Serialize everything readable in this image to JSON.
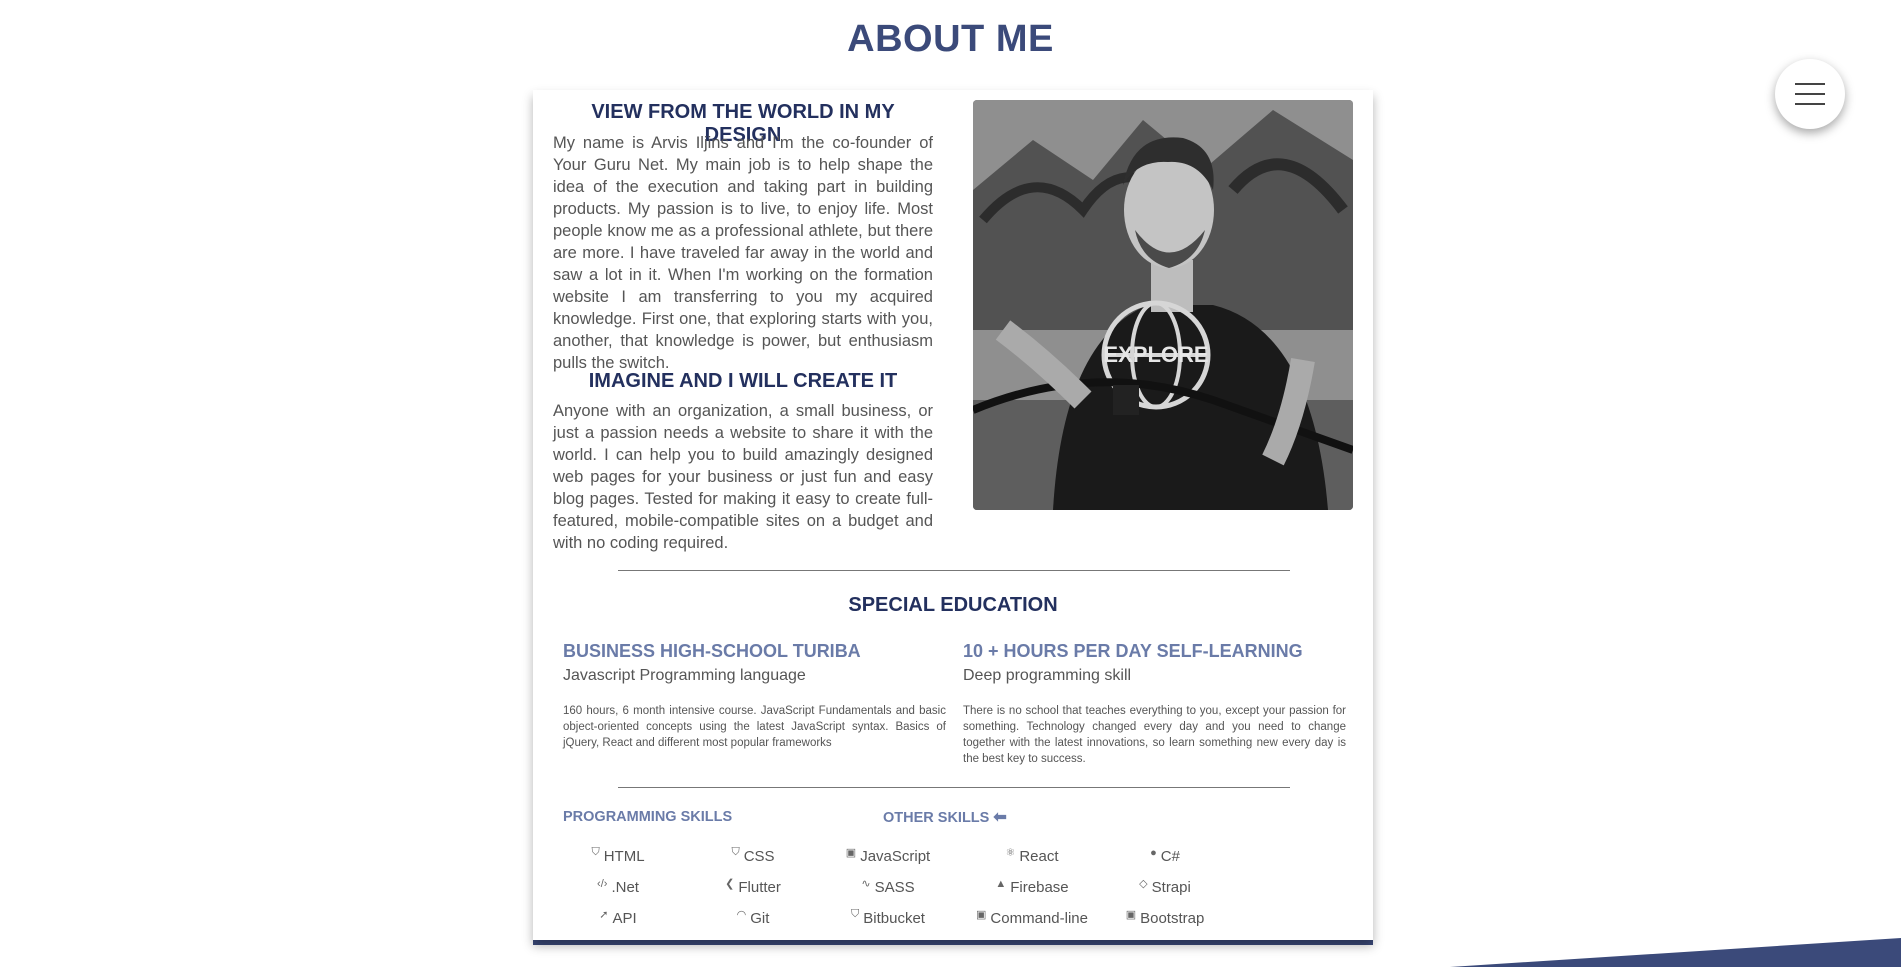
{
  "page": {
    "title": "ABOUT ME"
  },
  "about": {
    "heading1": "VIEW FROM THE WORLD IN MY DESIGN",
    "para1": "My name is Arvis Iljins and I'm the co-founder of Your Guru Net. My main job is to help shape the idea of the execution and taking part in building products. My passion is to live, to enjoy life. Most people know me as a professional athlete, but there are more. I have traveled far away in the world and saw a lot in it. When I'm working on the formation website I am transferring to you my acquired knowledge. First one, that exploring starts with you, another, that knowledge is power, but enthusiasm pulls the switch.",
    "heading2": "IMAGINE AND I WILL CREATE IT",
    "para2": "Anyone with an organization, a small business, or just a passion needs a website to share it with the world. I can help you to build amazingly designed web pages for your business or just fun and easy blog pages. Tested for making it easy to create full-featured, mobile-compatible sites on a budget and with no coding required.",
    "photo_shirt_text": "EXPLORE"
  },
  "education": {
    "heading": "SPECIAL EDUCATION",
    "left": {
      "title": "BUSINESS HIGH-SCHOOL TURIBA",
      "subtitle": "Javascript Programming language",
      "description": "160 hours, 6 month intensive course. JavaScript Fundamentals and basic object-oriented concepts using the latest JavaScript syntax. Basics of jQuery, React and different most popular frameworks"
    },
    "right": {
      "title": "10 + HOURS PER DAY SELF-LEARNING",
      "subtitle": "Deep programming skill",
      "description": "There is no school that teaches everything to you, except your passion for something. Technology changed every day and you need to change together with the latest innovations, so learn something new every day is the best key to success."
    }
  },
  "skills": {
    "programming_label": "PROGRAMMING SKILLS",
    "other_label": "OTHER SKILLS",
    "items": [
      {
        "label": "HTML",
        "icon": "html5-icon",
        "glyph": "⛉"
      },
      {
        "label": "CSS",
        "icon": "css3-icon",
        "glyph": "⛉"
      },
      {
        "label": "JavaScript",
        "icon": "js-icon",
        "glyph": "▣"
      },
      {
        "label": "React",
        "icon": "react-icon",
        "glyph": "⚛"
      },
      {
        "label": "C#",
        "icon": "csharp-icon",
        "glyph": "●"
      },
      {
        "label": ".Net",
        "icon": "code-icon",
        "glyph": "‹/›"
      },
      {
        "label": "Flutter",
        "icon": "flutter-icon",
        "glyph": "❮"
      },
      {
        "label": "SASS",
        "icon": "sass-icon",
        "glyph": "∿"
      },
      {
        "label": "Firebase",
        "icon": "firebase-icon",
        "glyph": "▲"
      },
      {
        "label": "Strapi",
        "icon": "strapi-icon",
        "glyph": "◇"
      },
      {
        "label": "API",
        "icon": "rocket-icon",
        "glyph": "➚"
      },
      {
        "label": "Git",
        "icon": "github-icon",
        "glyph": "◠"
      },
      {
        "label": "Bitbucket",
        "icon": "bitbucket-icon",
        "glyph": "⛉"
      },
      {
        "label": "Command-line",
        "icon": "terminal-icon",
        "glyph": "▣"
      },
      {
        "label": "Bootstrap",
        "icon": "bootstrap-icon",
        "glyph": "▣"
      }
    ]
  },
  "colors": {
    "accent": "#3b4a7a",
    "heading": "#23305e",
    "subheading": "#6a7ba8"
  }
}
